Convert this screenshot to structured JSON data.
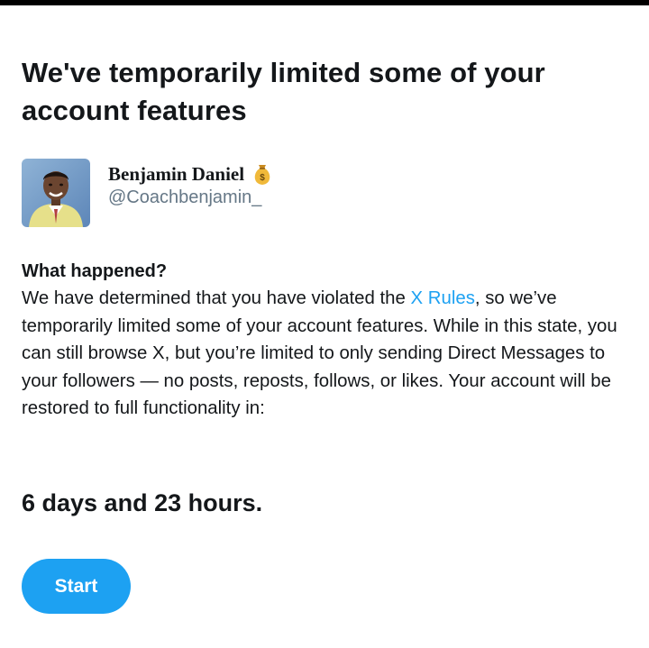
{
  "notice": {
    "headline": "We've temporarily limited some of your account features"
  },
  "account": {
    "display_name": "Benjamin Daniel",
    "handle": "@Coachbenjamin_",
    "name_emoji": "money-bag-icon"
  },
  "details": {
    "section_title": "What happened?",
    "body_before_link": "We have determined that you have violated the ",
    "link_text": "X Rules",
    "body_after_link": ", so we’ve temporarily limited some of your account features. While in this state, you can still browse X, but you’re limited to only sending Direct Messages to your followers — no posts, reposts, follows, or likes. Your account will be restored to full functionality in:"
  },
  "countdown": {
    "text": "6 days and 23 hours."
  },
  "actions": {
    "start_label": "Start"
  },
  "colors": {
    "accent": "#1da1f2",
    "text": "#14171a",
    "secondary_text": "#657786"
  }
}
